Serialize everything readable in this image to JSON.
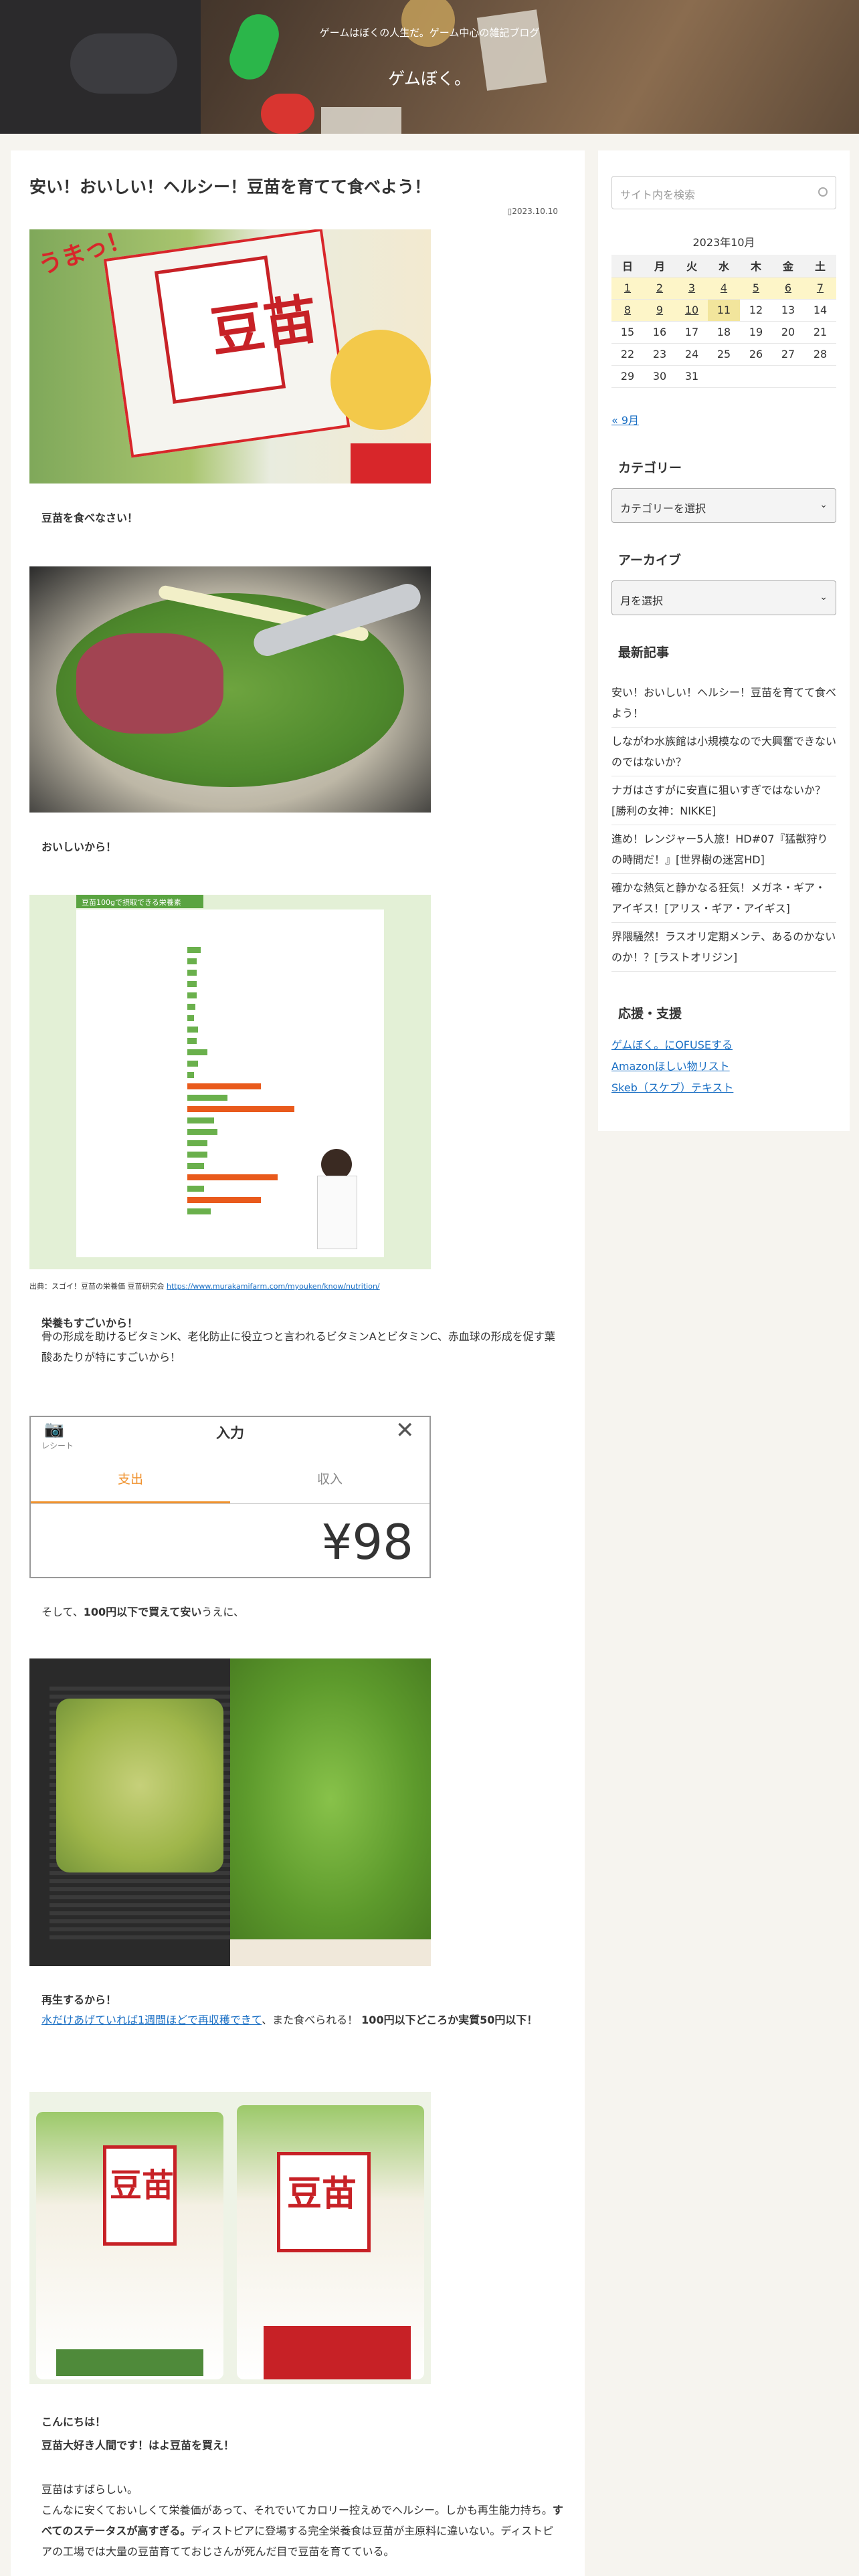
{
  "site": {
    "description": "ゲームはぼくの人生だ。ゲーム中心の雑記ブログ",
    "title": "ゲムぼく。"
  },
  "post": {
    "title": "安い！おいしい！ヘルシー！豆苗を育てて食べよう！",
    "date": "2023.10.10",
    "cap1": "豆苗を食べなさい！",
    "cap2": "おいしいから！",
    "chart_title": "豆苗100gで摂取できる栄養素",
    "source_prefix": "出典：スゴイ！豆苗の栄養価 豆苗研究会",
    "source_url": "https://www.murakamifarm.com/myouken/know/nutrition/",
    "cap3": "栄養もすごいから！",
    "para3": "骨の形成を助けるビタミンK、老化防止に役立つと言われるビタミンAとビタミンC、赤血球の形成を促す葉酸あたりが特にすごいから！",
    "app": {
      "receipt": "レシート",
      "title": "入力",
      "tab_expense": "支出",
      "tab_income": "収入",
      "amount": "¥98"
    },
    "price_pre": "そして、",
    "price_bold": "100円以下で買えて安い",
    "price_post": "うえに、",
    "cap5": "再生するから！",
    "regrow_link": "水だけあげていれば1週間ほどで再収穫できて",
    "regrow_mid": "、また食べられる！",
    "regrow_bold": "100円以下どころか実質50円以下！",
    "hello": "こんにちは！",
    "love": "豆苗大好き人間です！はよ豆苗を買え！",
    "p1": "豆苗はすばらしい。",
    "p2a": "こんなに安くておいしくて栄養価があって、それでいてカロリー控えめでヘルシー。しかも再生能力持ち。",
    "p2b": "すべてのステータスが高すぎる。",
    "p2c": "ディストピアに登場する完全栄養食は豆苗が主原料に違いない。ディストピアの工場では大量の豆苗育てておじさんが死んだ目で豆苗を育てている。"
  },
  "sidebar": {
    "search_placeholder": "サイト内を検索",
    "calendar": {
      "caption": "2023年10月",
      "headers": [
        "日",
        "月",
        "火",
        "水",
        "木",
        "金",
        "土"
      ],
      "rows": [
        [
          "1",
          "2",
          "3",
          "4",
          "5",
          "6",
          "7"
        ],
        [
          "8",
          "9",
          "10",
          "11",
          "12",
          "13",
          "14"
        ],
        [
          "15",
          "16",
          "17",
          "18",
          "19",
          "20",
          "21"
        ],
        [
          "22",
          "23",
          "24",
          "25",
          "26",
          "27",
          "28"
        ],
        [
          "29",
          "30",
          "31",
          "",
          "",
          "",
          ""
        ]
      ],
      "prev": "« 9月"
    },
    "category_title": "カテゴリー",
    "category_select": "カテゴリーを選択",
    "archive_title": "アーカイブ",
    "archive_select": "月を選択",
    "recent_title": "最新記事",
    "recent": [
      "安い！おいしい！ヘルシー！豆苗を育てて食べよう！",
      "しながわ水族館は小規模なので大興奮できないのではないか？",
      "ナガはさすがに安直に狙いすぎではないか？[勝利の女神：NIKKE]",
      "進め！レンジャー5人旅！HD#07『猛獣狩りの時間だ！』[世界樹の迷宮HD]",
      "確かな熱気と静かなる狂気！メガネ・ギア・アイギス！[アリス・ギア・アイギス]",
      "界隈騒然！ラスオリ定期メンテ、あるのかないのか！？[ラストオリジン]"
    ],
    "support_title": "応援・支援",
    "support": [
      "ゲムぼく。にOFUSEする",
      "Amazonほしい物リスト",
      "Skeb（スケブ）テキスト"
    ]
  },
  "colors": {
    "accent": "#1a6fc4",
    "expense": "#f0922e",
    "today": "#f2e59c"
  }
}
